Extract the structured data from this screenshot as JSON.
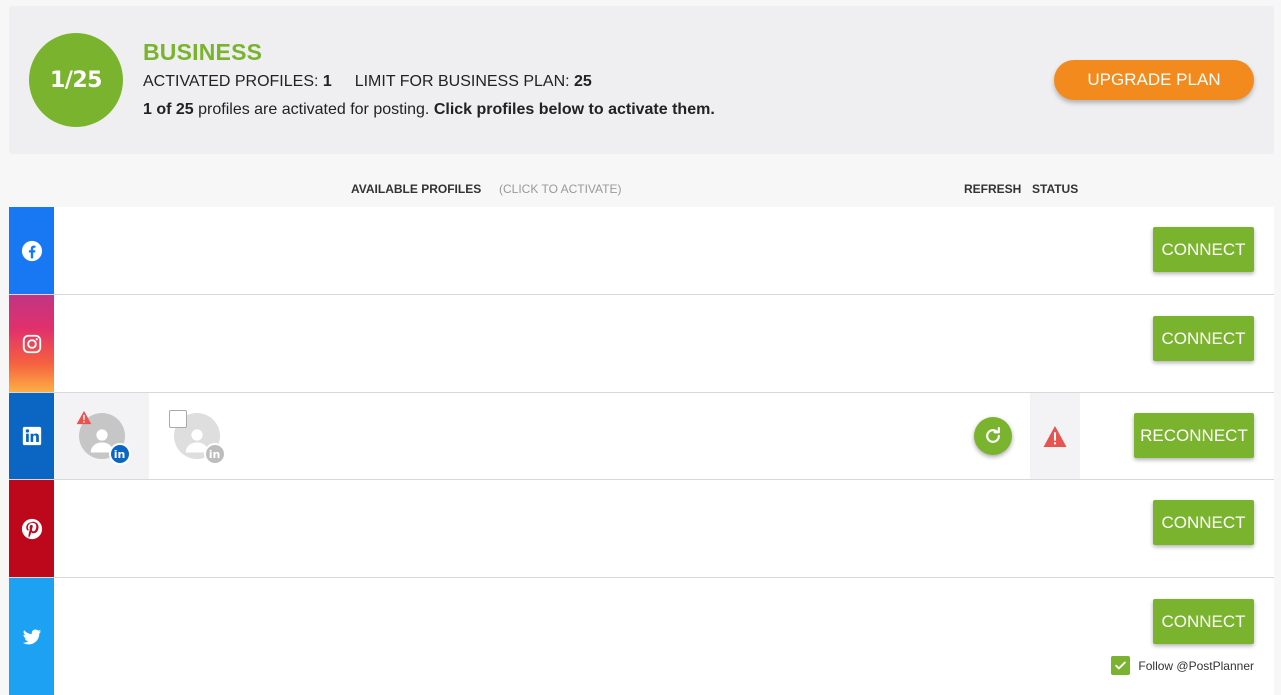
{
  "plan": {
    "badge": "1/25",
    "name": "BUSINESS",
    "activated_label": "ACTIVATED PROFILES:",
    "activated_value": "1",
    "limit_label": "LIMIT FOR BUSINESS PLAN:",
    "limit_value": "25",
    "summary_count": "1 of 25",
    "summary_text": " profiles are activated for posting. ",
    "summary_cta": "Click profiles below to activate them.",
    "upgrade_label": "UPGRADE PLAN"
  },
  "columns": {
    "available": "AVAILABLE PROFILES",
    "available_hint": "(CLICK TO ACTIVATE)",
    "refresh": "REFRESH",
    "status": "STATUS"
  },
  "networks": [
    {
      "name": "facebook",
      "icon": "facebook-icon",
      "button": "CONNECT"
    },
    {
      "name": "instagram",
      "icon": "instagram-icon",
      "button": "CONNECT"
    },
    {
      "name": "linkedin",
      "icon": "linkedin-icon",
      "button": "RECONNECT"
    },
    {
      "name": "pinterest",
      "icon": "pinterest-icon",
      "button": "CONNECT"
    },
    {
      "name": "twitter",
      "icon": "twitter-icon",
      "button": "CONNECT"
    }
  ],
  "linkedin_profiles": [
    {
      "state": "active",
      "warning": true,
      "badge": "in"
    },
    {
      "state": "inactive",
      "checked": false,
      "badge": "in"
    }
  ],
  "twitter": {
    "follow_label": "Follow @PostPlanner",
    "follow_checked": true
  },
  "colors": {
    "brand_green": "#7ab32e",
    "upgrade_orange": "#f28a1e",
    "warning_red": "#e8534f",
    "facebook": "#1877f2",
    "linkedin": "#0a66c2",
    "pinterest": "#bd081c",
    "twitter": "#1da1f2"
  }
}
